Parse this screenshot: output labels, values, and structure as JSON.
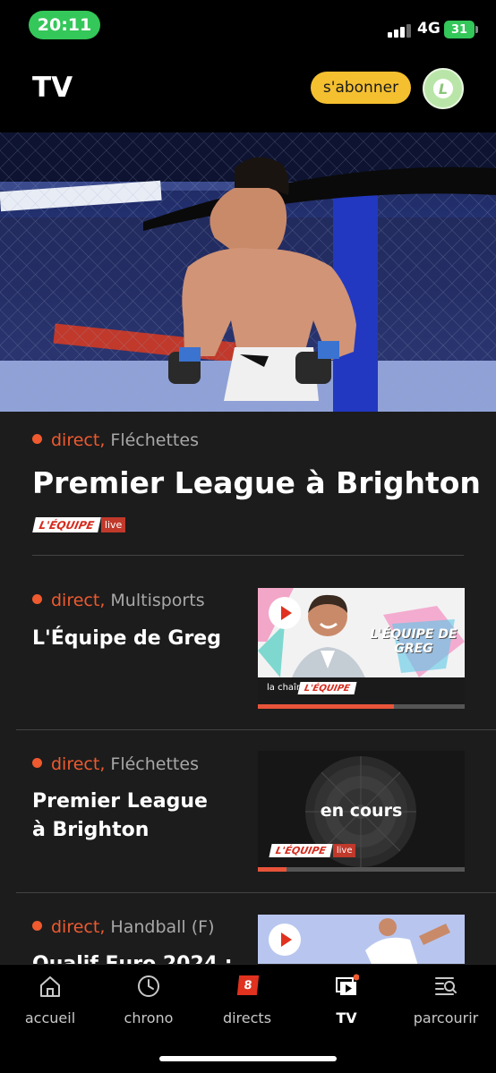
{
  "status_bar": {
    "time": "20:11",
    "network": "4G",
    "battery": "31"
  },
  "header": {
    "title": "TV",
    "subscribe_label": "s'abonner",
    "avatar_letter": "L"
  },
  "hero": {
    "live_label": "direct,",
    "category": "Fléchettes",
    "title": "Premier League à Brighton",
    "brand": "L'ÉQUIPE",
    "brand_tag": "live"
  },
  "rows": [
    {
      "live_label": "direct,",
      "category": "Multisports",
      "title": "L'Équipe de Greg",
      "thumb_caption_small": "la chaîne",
      "thumb_brand": "L'ÉQUIPE",
      "thumb_overlay": "L'ÉQUIPE DE GREG",
      "progress": 0.66
    },
    {
      "live_label": "direct,",
      "category": "Fléchettes",
      "title": "Premier League à Brighton",
      "thumb_status": "en cours",
      "thumb_brand": "L'ÉQUIPE",
      "thumb_brand_tag": "live",
      "progress": 0.14
    },
    {
      "live_label": "direct,",
      "category": "Handball (F)",
      "title": "Qualif Euro 2024 :"
    }
  ],
  "tabs": [
    {
      "label": "accueil",
      "icon": "home-icon"
    },
    {
      "label": "chrono",
      "icon": "clock-icon"
    },
    {
      "label": "directs",
      "icon": "live-badge-icon",
      "badge": "8"
    },
    {
      "label": "TV",
      "icon": "tv-play-icon",
      "active": true
    },
    {
      "label": "parcourir",
      "icon": "browse-search-icon"
    }
  ],
  "colors": {
    "accent_live": "#ef5a2f",
    "subscribe": "#f5c030",
    "background": "#1c1c1c"
  }
}
